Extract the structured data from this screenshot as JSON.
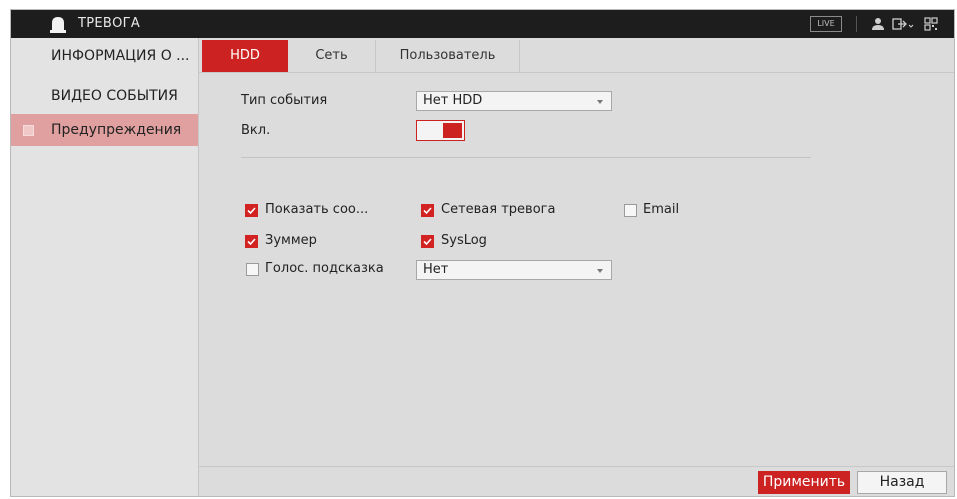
{
  "header": {
    "title": "ТРЕВОГА",
    "live_label": "LIVE",
    "icons": [
      "alarm-bell-icon",
      "user-icon",
      "logout-icon",
      "qr-code-icon"
    ]
  },
  "sidebar": {
    "items": [
      {
        "label": "ИНФОРМАЦИЯ О ...",
        "active": false
      },
      {
        "label": "ВИДЕО СОБЫТИЯ",
        "active": false
      },
      {
        "label": "Предупреждения",
        "active": true
      }
    ]
  },
  "tabs": [
    {
      "label": "HDD",
      "active": true
    },
    {
      "label": "Сеть",
      "active": false
    },
    {
      "label": "Пользователь",
      "active": false
    }
  ],
  "form": {
    "event_type_label": "Тип события",
    "event_type_value": "Нет HDD",
    "enable_label": "Вкл.",
    "enable_on": true,
    "checkboxes": {
      "show_message": {
        "label": "Показать соо...",
        "checked": true
      },
      "network_alarm": {
        "label": "Сетевая тревога",
        "checked": true
      },
      "email": {
        "label": "Email",
        "checked": false
      },
      "buzzer": {
        "label": "Зуммер",
        "checked": true
      },
      "syslog": {
        "label": "SysLog",
        "checked": true
      },
      "voice_prompt": {
        "label": "Голос. подсказка",
        "checked": false
      }
    },
    "voice_prompt_value": "Нет"
  },
  "buttons": {
    "apply": "Применить",
    "back": "Назад"
  },
  "colors": {
    "accent": "#cc2222",
    "sidebar_active": "#e1a0a0",
    "topbar": "#1d1d1d",
    "background": "#dcdcdc"
  }
}
